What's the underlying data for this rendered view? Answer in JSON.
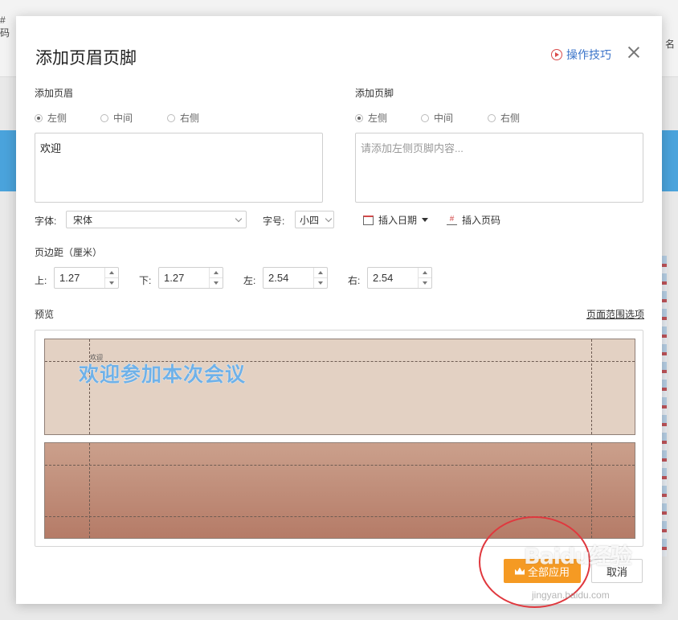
{
  "background": {
    "left_tab_top": "#",
    "left_tab_bottom": "码",
    "right_tab": "名"
  },
  "dialog": {
    "title": "添加页眉页脚",
    "tips_label": "操作技巧",
    "header_section": {
      "label": "添加页眉",
      "positions": [
        "左侧",
        "中间",
        "右侧"
      ],
      "selected": "左侧",
      "text": "欢迎",
      "placeholder": ""
    },
    "footer_section": {
      "label": "添加页脚",
      "positions": [
        "左侧",
        "中间",
        "右侧"
      ],
      "selected": "左侧",
      "text": "",
      "placeholder": "请添加左侧页脚内容..."
    },
    "font": {
      "label": "字体:",
      "value": "宋体"
    },
    "font_size": {
      "label": "字号:",
      "value": "小四"
    },
    "insert_date_label": "插入日期",
    "insert_page_label": "插入页码",
    "margins": {
      "label": "页边距（厘米）",
      "top": {
        "label": "上:",
        "value": "1.27"
      },
      "bottom": {
        "label": "下:",
        "value": "1.27"
      },
      "left": {
        "label": "左:",
        "value": "2.54"
      },
      "right": {
        "label": "右:",
        "value": "2.54"
      }
    },
    "preview": {
      "label": "预览",
      "range_link": "页面范围选项",
      "header_text": "欢迎",
      "slide_title": "欢迎参加本次会议"
    },
    "apply_label": "全部应用",
    "cancel_label": "取消"
  },
  "watermark": {
    "logo": "Baidu经验",
    "url": "jingyan.baidu.com"
  },
  "colors": {
    "accent_blue": "#3b74c9",
    "apply_orange": "#f59a23",
    "annotation_red": "#e0383e",
    "slide_light": "#e3d1c3",
    "slide_dark": "#b57b67"
  }
}
